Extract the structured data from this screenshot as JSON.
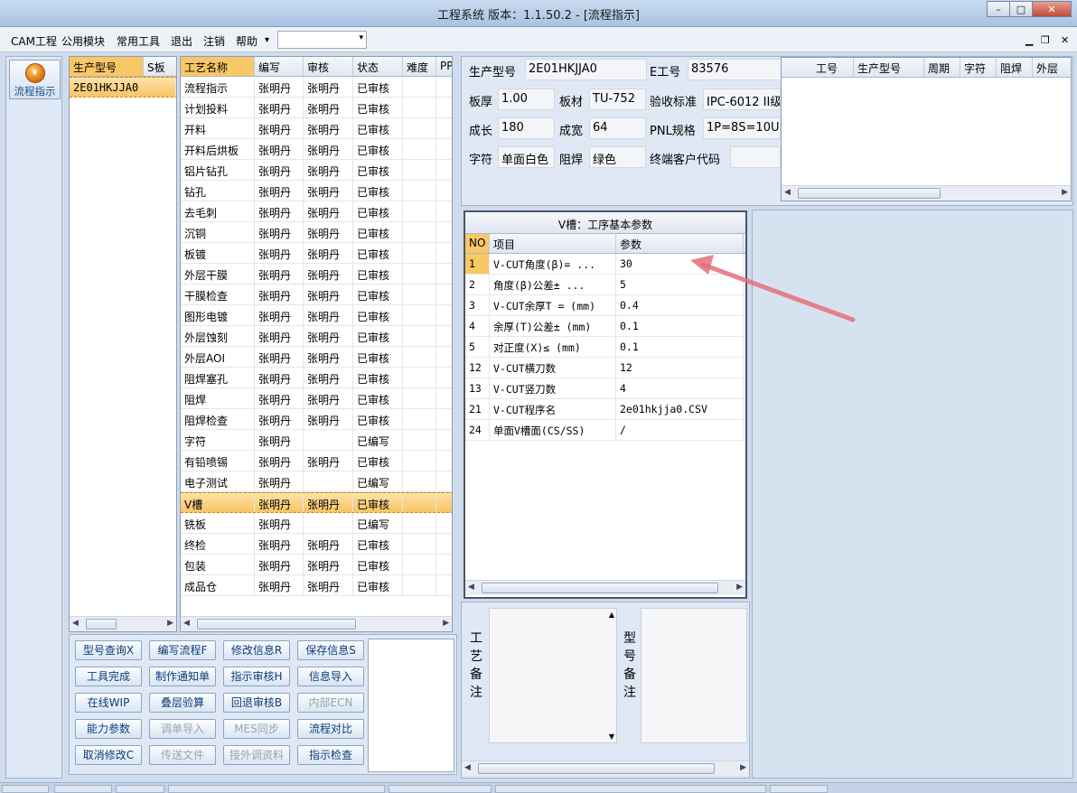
{
  "window": {
    "title": "工程系统   版本：1.1.50.2 - [流程指示]",
    "buttons": {
      "minimize": "–",
      "maximize": "□",
      "close": "✕"
    }
  },
  "menu": {
    "items": [
      "CAM工程",
      "公用模块",
      "常用工具",
      "退出",
      "注销",
      "帮助"
    ],
    "help_arrow": "▾",
    "combo_value": "",
    "mdi": {
      "minimize": "▁",
      "restore": "❐",
      "close": "✕"
    }
  },
  "nav": {
    "label": "流程指示",
    "icon": "process-icon"
  },
  "models": {
    "headers": [
      "生产型号",
      "S板"
    ],
    "rows": [
      [
        "2E01HKJJA0",
        ""
      ]
    ]
  },
  "processes": {
    "headers": [
      "工艺名称",
      "编写",
      "审核",
      "状态",
      "难度",
      "PP"
    ],
    "rows": [
      [
        "流程指示",
        "张明丹",
        "张明丹",
        "已审核"
      ],
      [
        "计划投料",
        "张明丹",
        "张明丹",
        "已审核"
      ],
      [
        "开料",
        "张明丹",
        "张明丹",
        "已审核"
      ],
      [
        "开料后烘板",
        "张明丹",
        "张明丹",
        "已审核"
      ],
      [
        "铝片钻孔",
        "张明丹",
        "张明丹",
        "已审核"
      ],
      [
        "钻孔",
        "张明丹",
        "张明丹",
        "已审核"
      ],
      [
        "去毛刺",
        "张明丹",
        "张明丹",
        "已审核"
      ],
      [
        "沉铜",
        "张明丹",
        "张明丹",
        "已审核"
      ],
      [
        "板镀",
        "张明丹",
        "张明丹",
        "已审核"
      ],
      [
        "外层干膜",
        "张明丹",
        "张明丹",
        "已审核"
      ],
      [
        "干膜检查",
        "张明丹",
        "张明丹",
        "已审核"
      ],
      [
        "图形电镀",
        "张明丹",
        "张明丹",
        "已审核"
      ],
      [
        "外层蚀刻",
        "张明丹",
        "张明丹",
        "已审核"
      ],
      [
        "外层AOI",
        "张明丹",
        "张明丹",
        "已审核"
      ],
      [
        "阻焊塞孔",
        "张明丹",
        "张明丹",
        "已审核"
      ],
      [
        "阻焊",
        "张明丹",
        "张明丹",
        "已审核"
      ],
      [
        "阻焊检查",
        "张明丹",
        "张明丹",
        "已审核"
      ],
      [
        "字符",
        "张明丹",
        "",
        "已编写"
      ],
      [
        "有铅喷锡",
        "张明丹",
        "张明丹",
        "已审核"
      ],
      [
        "电子测试",
        "张明丹",
        "",
        "已编写"
      ],
      [
        "V槽",
        "张明丹",
        "张明丹",
        "已审核"
      ],
      [
        "铣板",
        "张明丹",
        "",
        "已编写"
      ],
      [
        "终检",
        "张明丹",
        "张明丹",
        "已审核"
      ],
      [
        "包装",
        "张明丹",
        "张明丹",
        "已审核"
      ],
      [
        "成品仓",
        "张明丹",
        "张明丹",
        "已审核"
      ]
    ],
    "selected_index": 20
  },
  "actions": [
    [
      "型号查询X",
      "编写流程F",
      "修改信息R",
      "保存信息S"
    ],
    [
      "工具完成",
      "制作通知单",
      "指示审核H",
      "信息导入"
    ],
    [
      "在线WIP",
      "叠层验算",
      "回退审核B",
      "内部ECN"
    ],
    [
      "能力参数",
      "调单导入",
      "MES同步",
      "流程对比"
    ],
    [
      "取消修改C",
      "传送文件",
      "接外调资料",
      "指示检查"
    ]
  ],
  "disabled_actions": [
    "内部ECN",
    "调单导入",
    "MES同步",
    "传送文件",
    "接外调资料"
  ],
  "info": {
    "model_label": "生产型号",
    "model_value": "2E01HKJJA0",
    "e_label": "E工号",
    "e_value": "83576",
    "thick_label": "板厚",
    "thick_value": "1.00",
    "mat_label": "板材",
    "mat_value": "TU-752",
    "std_label": "验收标准",
    "std_value": "IPC-6012 II级",
    "len_label": "成长",
    "len_value": "180",
    "wid_label": "成宽",
    "wid_value": "64",
    "pnl_label": "PNL规格",
    "pnl_value": "1P=8S=10U",
    "char_label": "字符",
    "char_value": "单面白色",
    "mask_label": "阻焊",
    "mask_value": "绿色",
    "cust_label": "终端客户代码",
    "cust_value": ""
  },
  "side_grid": {
    "headers": [
      "工号",
      "生产型号",
      "周期",
      "字符",
      "阻焊",
      "外层"
    ]
  },
  "vcut": {
    "caption": "V槽：工序基本参数",
    "headers": [
      "NO",
      "项目",
      "参数"
    ],
    "rows": [
      [
        "1",
        "V-CUT角度(β)=  ...",
        "30"
      ],
      [
        "2",
        "角度(β)公差±  ...",
        "5"
      ],
      [
        "3",
        "V-CUT余厚T = (mm)",
        "0.4"
      ],
      [
        "4",
        "余厚(T)公差± (mm)",
        "0.1"
      ],
      [
        "5",
        "对正度(X)≤ (mm)",
        "0.1"
      ],
      [
        "12",
        "V-CUT横刀数",
        "12"
      ],
      [
        "13",
        "V-CUT竖刀数",
        "4"
      ],
      [
        "21",
        "V-CUT程序名",
        "2e01hkjja0.CSV"
      ],
      [
        "24",
        "单面V槽面(CS/SS)",
        "/"
      ]
    ]
  },
  "remarks": {
    "process_label": "工艺备注",
    "model_label": "型号备注"
  },
  "colors": {
    "selection": "#f8c766",
    "annotation_arrow": "#e4707a"
  }
}
